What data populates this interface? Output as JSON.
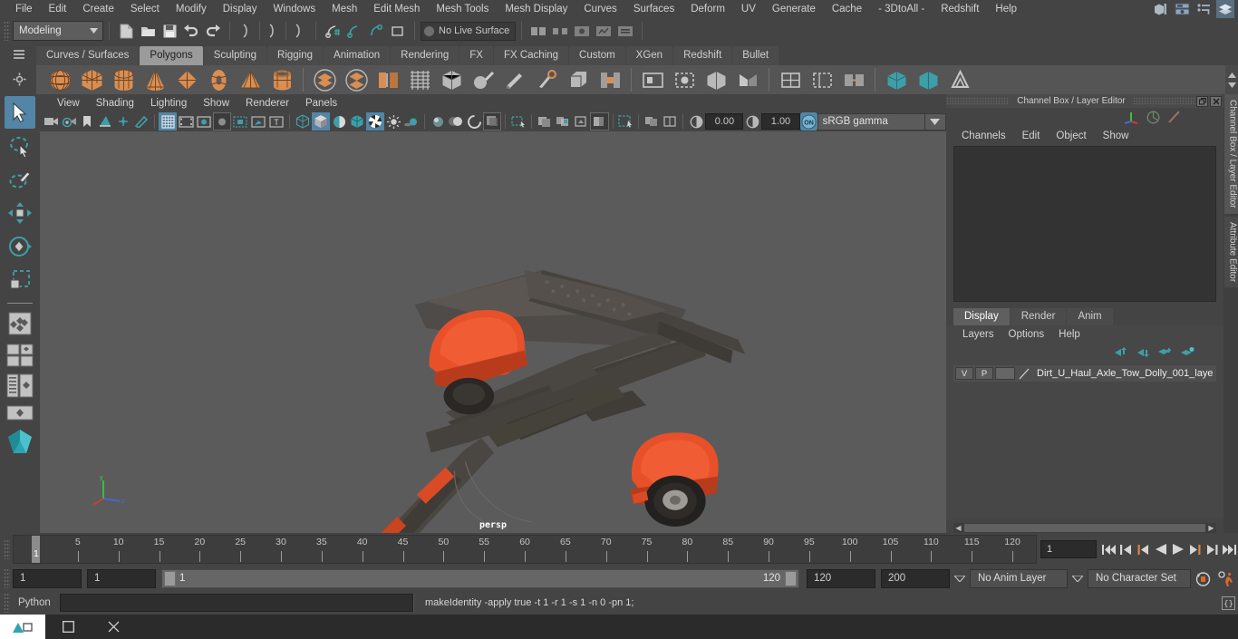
{
  "menu": {
    "items": [
      "File",
      "Edit",
      "Create",
      "Select",
      "Modify",
      "Display",
      "Windows",
      "Mesh",
      "Edit Mesh",
      "Mesh Tools",
      "Mesh Display",
      "Curves",
      "Surfaces",
      "Deform",
      "UV",
      "Generate",
      "Cache",
      "- 3DtoAll -",
      "Redshift",
      "Help"
    ]
  },
  "status_line": {
    "mode_label": "Modeling",
    "no_live_surface": "No Live Surface",
    "icons": [
      "new-scene-icon",
      "open-scene-icon",
      "save-scene-icon",
      "undo-icon",
      "redo-icon",
      "select-by-hierarchy-icon",
      "select-by-object-icon",
      "select-by-component-icon",
      "snap-to-grid-icon",
      "snap-to-curve-icon",
      "snap-to-point-icon"
    ],
    "right_icons": [
      "show-hide-editor-icon",
      "attribute-editor-icon",
      "tool-settings-icon",
      "channel-box-icon"
    ]
  },
  "shelf": {
    "tabs": [
      "Curves / Surfaces",
      "Polygons",
      "Sculpting",
      "Rigging",
      "Animation",
      "Rendering",
      "FX",
      "FX Caching",
      "Custom",
      "XGen",
      "Redshift",
      "Bullet"
    ],
    "active_tab": "Polygons",
    "icons": [
      "polysphere-icon",
      "polycube-icon",
      "polycylinder-icon",
      "polycone-icon",
      "polyplane-icon",
      "polytorus-icon",
      "polypyramid-icon",
      "polypipe-icon",
      "combine-icon",
      "separate-icon",
      "extract-icon",
      "booleans-icon",
      "smooth-icon",
      "sculpt-icon",
      "multicut-icon",
      "target-weld-icon",
      "bevel-icon",
      "bridge-icon",
      "append-polygon-icon",
      "wedge-icon",
      "mirror-icon",
      "quad-draw-icon",
      "uv-editor-icon",
      "normals-icon",
      "soften-icon",
      "harden-icon",
      "transfer-attributes-icon",
      "reduce-icon",
      "crease-icon"
    ]
  },
  "toolbox": {
    "items": [
      "select-tool",
      "lasso-select-tool",
      "paint-select-tool",
      "move-tool",
      "rotate-tool",
      "scale-tool",
      "last-tool",
      "single-view-layout",
      "four-view-layout",
      "persp-outliner-layout",
      "persp-graph-layout",
      "hypershade-layout",
      "maya-bonus-icon"
    ],
    "selected": "select-tool"
  },
  "viewport": {
    "panel_menu": [
      "View",
      "Shading",
      "Lighting",
      "Show",
      "Renderer",
      "Panels"
    ],
    "camera_label": "persp",
    "exposure_value": "0.00",
    "gamma_value": "1.00",
    "color_space": "sRGB gamma",
    "view_toolbar_icons": [
      "select-camera-icon",
      "camera-attributes-icon",
      "bookmark-icon",
      "image-plane-icon",
      "two-d-pan-zoom-icon",
      "grease-pencil-icon",
      "grid-toggle-icon",
      "film-gate-icon",
      "resolution-gate-icon",
      "gate-mask-icon",
      "film-origin-icon",
      "safe-action-icon",
      "title-safe-icon",
      "wireframe-icon",
      "smooth-shade-all-icon",
      "flat-shade-icon",
      "shaded-wireframe-icon",
      "textured-icon",
      "use-all-lights-icon",
      "shadows-icon",
      "screen-space-ao-icon",
      "motion-blur-icon",
      "multisample-icon",
      "depth-peeling-icon",
      "xray-icon",
      "xray-joints-icon",
      "xray-active-components-icon",
      "exposure-icon",
      "gamma-icon",
      "color-management-on-icon"
    ]
  },
  "channel_box": {
    "panel_title": "Channel Box / Layer Editor",
    "menus": [
      "Channels",
      "Edit",
      "Object",
      "Show"
    ],
    "header_icons": [
      "channel-box-icon",
      "attribute-editor-icon",
      "modeling-toolkit-icon"
    ],
    "vertical_tabs": [
      "Channel Box / Layer Editor",
      "Attribute Editor"
    ],
    "window_buttons": [
      "restore-panel-icon",
      "close-panel-icon"
    ]
  },
  "layer_editor": {
    "tabs": [
      "Display",
      "Render",
      "Anim"
    ],
    "active_tab": "Display",
    "menus": [
      "Layers",
      "Options",
      "Help"
    ],
    "button_icons": [
      "move-layer-up-icon",
      "move-layer-down-icon",
      "new-layer-icon",
      "new-layer-from-selected-icon"
    ],
    "layers": [
      {
        "visibility": "V",
        "playback": "P",
        "color_swatch": "#666666",
        "name": "Dirt_U_Haul_Axle_Tow_Dolly_001_laye"
      }
    ]
  },
  "timeline": {
    "ticks": [
      5,
      10,
      15,
      20,
      25,
      30,
      35,
      40,
      45,
      50,
      55,
      60,
      65,
      70,
      75,
      80,
      85,
      90,
      95,
      100,
      105,
      110,
      115,
      120
    ],
    "current_frame": "1",
    "current_frame_field": "1",
    "playback_icons": [
      "go-to-start-icon",
      "step-back-keyframe-icon",
      "step-back-frame-icon",
      "play-backwards-icon",
      "play-forwards-icon",
      "step-forward-frame-icon",
      "step-forward-keyframe-icon",
      "go-to-end-icon"
    ]
  },
  "range_slider": {
    "anim_start": "1",
    "range_start": "1",
    "slider_left_label": "1",
    "slider_right_label": "120",
    "range_end": "120",
    "anim_end": "200",
    "anim_layer": "No Anim Layer",
    "character_set": "No Character Set",
    "right_icons": [
      "auto-keyframe-icon",
      "animation-preferences-icon"
    ]
  },
  "command_line": {
    "language_label": "Python",
    "input_value": "",
    "output_text": "makeIdentity -apply true -t 1 -r 1 -s 1 -n 0 -pn 1;",
    "script_editor_icon": "script-editor-icon"
  },
  "taskbar": {
    "items": [
      "maya-app-icon",
      "window-restore-icon",
      "window-close-icon"
    ]
  },
  "colors": {
    "accent_blue": "#5285a6",
    "shelf_orange": "#d98e52",
    "teal": "#3f9fa8",
    "bg": "#444444",
    "viewport_bg": "#5b5b5b"
  }
}
